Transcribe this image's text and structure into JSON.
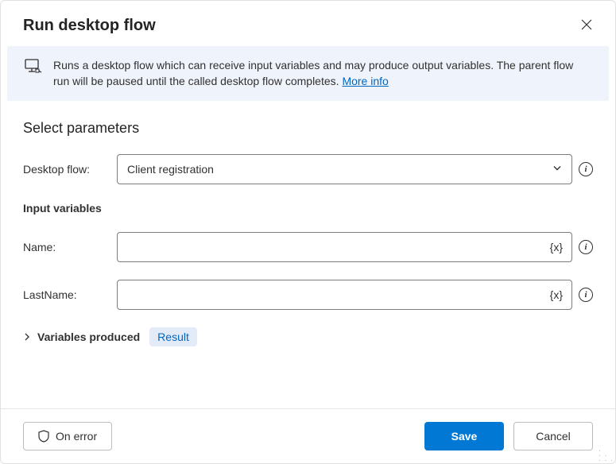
{
  "title": "Run desktop flow",
  "banner": {
    "text": "Runs a desktop flow which can receive input variables and may produce output variables. The parent flow run will be paused until the called desktop flow completes. ",
    "link_label": "More info"
  },
  "section_title": "Select parameters",
  "fields": {
    "desktop_flow": {
      "label": "Desktop flow:",
      "value": "Client registration"
    },
    "input_heading": "Input variables",
    "name": {
      "label": "Name:",
      "value": ""
    },
    "lastname": {
      "label": "LastName:",
      "value": ""
    }
  },
  "vars_produced": {
    "label": "Variables produced",
    "badge": "Result"
  },
  "buttons": {
    "on_error": "On error",
    "save": "Save",
    "cancel": "Cancel"
  },
  "glyphs": {
    "variable": "{x}"
  }
}
